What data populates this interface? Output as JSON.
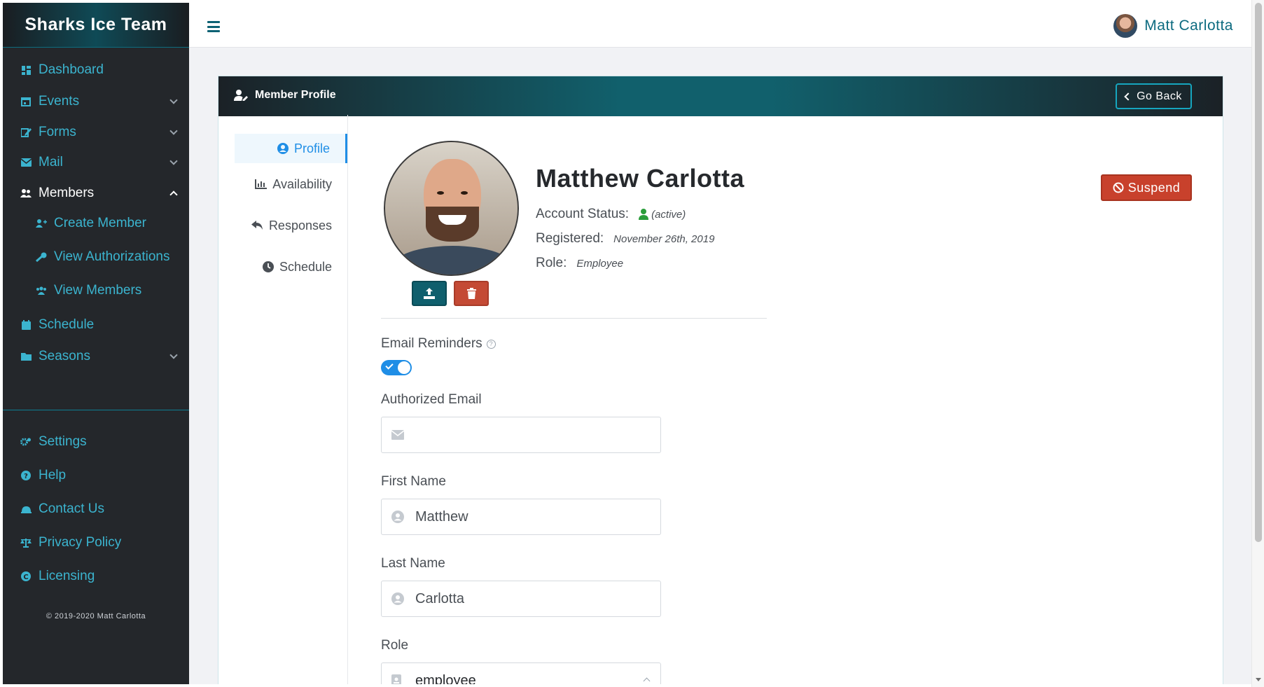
{
  "brand": {
    "title": "Sharks Ice Team"
  },
  "sidebar": {
    "items": [
      {
        "label": "Dashboard",
        "icon": "dashboard-icon"
      },
      {
        "label": "Events",
        "icon": "calendar-icon",
        "chevron": "down"
      },
      {
        "label": "Forms",
        "icon": "edit-icon",
        "chevron": "down"
      },
      {
        "label": "Mail",
        "icon": "mail-icon",
        "chevron": "down"
      },
      {
        "label": "Members",
        "icon": "users-icon",
        "chevron": "up",
        "active": true
      },
      {
        "label": "Create Member",
        "icon": "user-plus-icon",
        "sub": true
      },
      {
        "label": "View Authorizations",
        "icon": "key-icon",
        "sub": true
      },
      {
        "label": "View Members",
        "icon": "users-icon",
        "sub": true
      },
      {
        "label": "Schedule",
        "icon": "calendar-icon"
      },
      {
        "label": "Seasons",
        "icon": "folder-icon",
        "chevron": "down"
      }
    ],
    "footer_items": [
      {
        "label": "Settings",
        "icon": "gears-icon"
      },
      {
        "label": "Help",
        "icon": "question-icon"
      },
      {
        "label": "Contact Us",
        "icon": "bell-icon"
      },
      {
        "label": "Privacy Policy",
        "icon": "scale-icon"
      },
      {
        "label": "Licensing",
        "icon": "copyright-icon"
      }
    ],
    "copyright": "© 2019-2020 Matt Carlotta"
  },
  "topbar": {
    "user_name": "Matt Carlotta"
  },
  "card": {
    "title": "Member Profile",
    "go_back": "Go Back"
  },
  "tabs": [
    {
      "label": "Profile",
      "active": true
    },
    {
      "label": "Availability"
    },
    {
      "label": "Responses"
    },
    {
      "label": "Schedule"
    }
  ],
  "profile": {
    "name": "Matthew Carlotta",
    "status_label": "Account Status:",
    "status_value": "(active)",
    "registered_label": "Registered:",
    "registered_value": "November 26th, 2019",
    "role_label": "Role:",
    "role_value": "Employee",
    "suspend_label": "Suspend"
  },
  "form": {
    "email_reminders_label": "Email Reminders",
    "email_reminders_on": true,
    "authorized_email_label": "Authorized Email",
    "authorized_email_value": "",
    "first_name_label": "First Name",
    "first_name_value": "Matthew",
    "last_name_label": "Last Name",
    "last_name_value": "Carlotta",
    "role_label": "Role",
    "role_value": "employee"
  },
  "colors": {
    "accent": "#1f8ee6",
    "sidebar_bg": "#24272b",
    "sidebar_link": "#3bb4cf",
    "danger": "#c8412c",
    "teal": "#0f5f6d",
    "active_green": "#2a9d3a"
  }
}
